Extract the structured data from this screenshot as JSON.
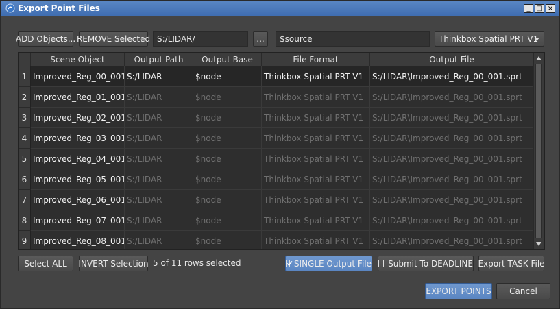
{
  "window": {
    "title": "Export Point Files"
  },
  "toolbar": {
    "add_label": "ADD Objects...",
    "remove_label": "REMOVE Selected",
    "path_value": "S:/LIDAR/",
    "browse_label": "...",
    "base_value": "$source",
    "format_selected": "Thinkbox Spatial PRT V1"
  },
  "table": {
    "columns": [
      "Scene Object",
      "Output Path",
      "Output Base",
      "File Format",
      "Output File"
    ],
    "rows": [
      {
        "num": "1",
        "object": "Improved_Reg_00_001",
        "path": "S:/LIDAR",
        "base": "$node",
        "format": "Thinkbox Spatial PRT V1",
        "file": "S:/LIDAR\\Improved_Reg_00_001.sprt"
      },
      {
        "num": "2",
        "object": "Improved_Reg_01_001",
        "path": "S:/LIDAR",
        "base": "$node",
        "format": "Thinkbox Spatial PRT V1",
        "file": "S:/LIDAR\\Improved_Reg_00_001.sprt"
      },
      {
        "num": "3",
        "object": "Improved_Reg_02_001",
        "path": "S:/LIDAR",
        "base": "$node",
        "format": "Thinkbox Spatial PRT V1",
        "file": "S:/LIDAR\\Improved_Reg_00_001.sprt"
      },
      {
        "num": "4",
        "object": "Improved_Reg_03_001",
        "path": "S:/LIDAR",
        "base": "$node",
        "format": "Thinkbox Spatial PRT V1",
        "file": "S:/LIDAR\\Improved_Reg_00_001.sprt"
      },
      {
        "num": "5",
        "object": "Improved_Reg_04_001",
        "path": "S:/LIDAR",
        "base": "$node",
        "format": "Thinkbox Spatial PRT V1",
        "file": "S:/LIDAR\\Improved_Reg_00_001.sprt"
      },
      {
        "num": "6",
        "object": "Improved_Reg_05_001",
        "path": "S:/LIDAR",
        "base": "$node",
        "format": "Thinkbox Spatial PRT V1",
        "file": "S:/LIDAR\\Improved_Reg_00_001.sprt"
      },
      {
        "num": "7",
        "object": "Improved_Reg_06_001",
        "path": "S:/LIDAR",
        "base": "$node",
        "format": "Thinkbox Spatial PRT V1",
        "file": "S:/LIDAR\\Improved_Reg_00_001.sprt"
      },
      {
        "num": "8",
        "object": "Improved_Reg_07_001",
        "path": "S:/LIDAR",
        "base": "$node",
        "format": "Thinkbox Spatial PRT V1",
        "file": "S:/LIDAR\\Improved_Reg_00_001.sprt"
      },
      {
        "num": "9",
        "object": "Improved_Reg_08_001",
        "path": "S:/LIDAR",
        "base": "$node",
        "format": "Thinkbox Spatial PRT V1",
        "file": "S:/LIDAR\\Improved_Reg_00_001.sprt"
      }
    ]
  },
  "footer": {
    "select_all_label": "Select ALL",
    "invert_label": "INVERT Selection",
    "status_text": "5 of 11 rows selected",
    "single_output_label": "SINGLE Output File",
    "single_output_checked": true,
    "deadline_label": "Submit To DEADLINE",
    "deadline_checked": false,
    "export_task_label": "Export TASK File",
    "export_points_label": "EXPORT POINTS",
    "cancel_label": "Cancel"
  },
  "colors": {
    "accent": "#5b86c2",
    "titlebar": "#3e6cb0",
    "background": "#444444"
  }
}
